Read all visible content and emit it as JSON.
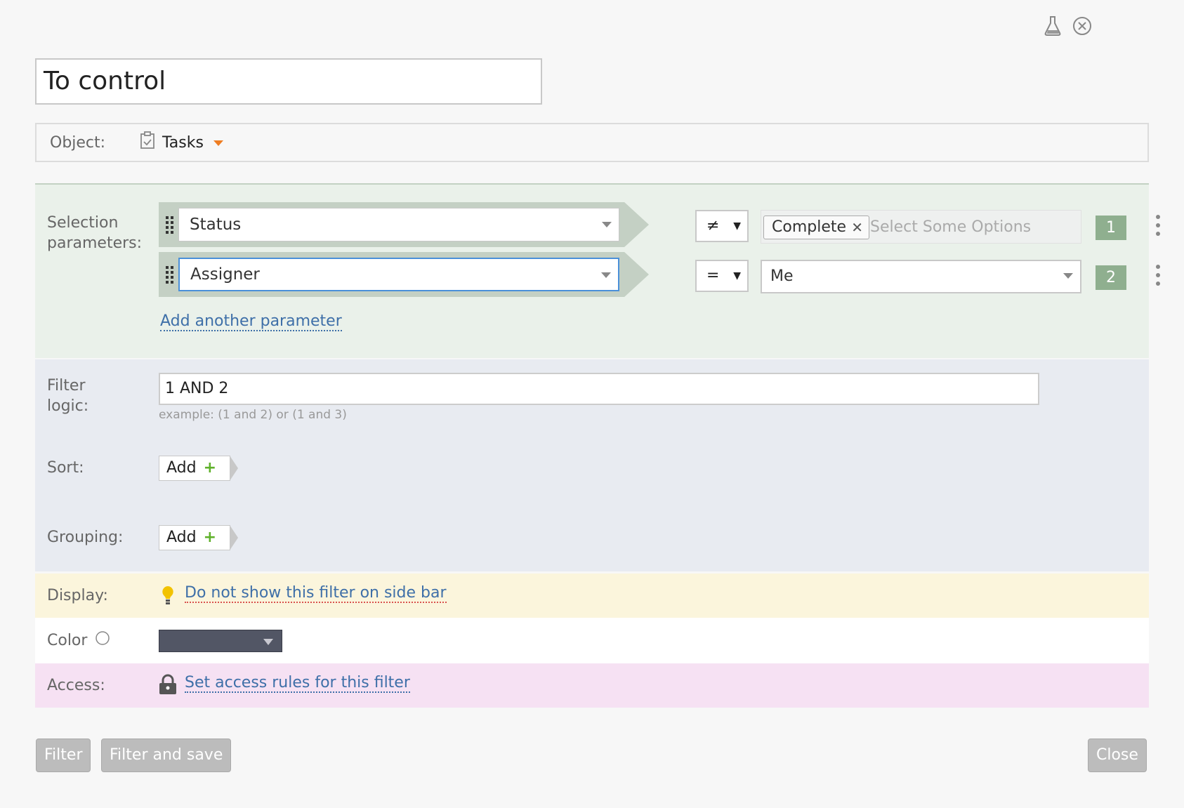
{
  "form": {
    "title_value": "To control",
    "object": {
      "label": "Object:",
      "value": "Tasks"
    }
  },
  "selection": {
    "label": "Selection parameters:",
    "rows": [
      {
        "field": "Status",
        "operator": "≠",
        "values": [
          "Complete"
        ],
        "placeholder": "Select Some Options",
        "index": "1"
      },
      {
        "field": "Assigner",
        "operator": "=",
        "value": "Me",
        "index": "2"
      }
    ],
    "add_link": "Add another parameter"
  },
  "logic": {
    "label": "Filter logic:",
    "value": "1 AND 2",
    "hint": "example: (1 and 2) or (1 and 3)"
  },
  "sort": {
    "label": "Sort:",
    "button": "Add"
  },
  "grouping": {
    "label": "Grouping:",
    "button": "Add"
  },
  "display": {
    "label": "Display:",
    "link": "Do not show this filter on side bar"
  },
  "color": {
    "label": "Color",
    "swatch": "#525665"
  },
  "access": {
    "label": "Access:",
    "link": "Set access rules for this filter"
  },
  "footer": {
    "filter": "Filter",
    "filter_save": "Filter and save",
    "close": "Close"
  },
  "icons": {
    "top": [
      "flask-icon",
      "close-circle-icon"
    ],
    "object": "clipboard-check-icon",
    "display": "lightbulb-icon",
    "access": "lock-icon"
  },
  "colors": {
    "selection_bg": "#eaf1ea",
    "logic_bg": "#e8ebf1",
    "display_bg": "#fbf5dc",
    "access_bg": "#f6e1f3",
    "badge": "#8faf8f",
    "link": "#3e6fa8",
    "accent_orange": "#ee7d22"
  }
}
